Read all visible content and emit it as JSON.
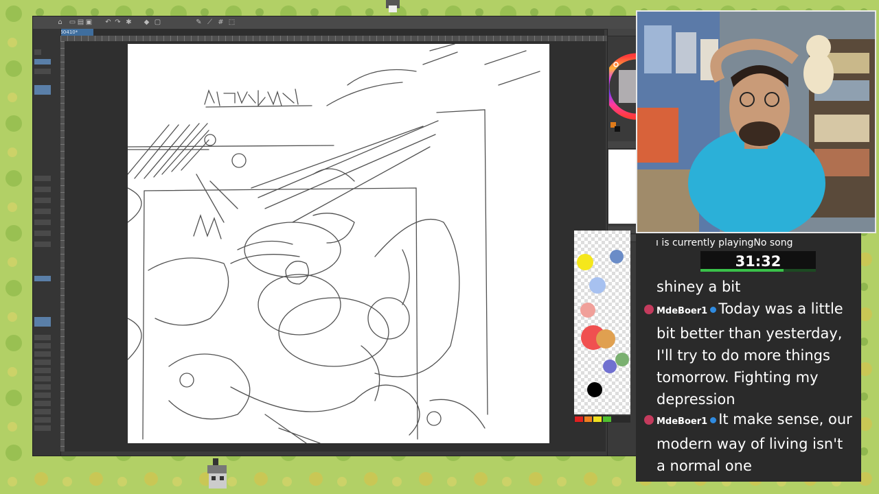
{
  "app": {
    "document_tab": "260410*"
  },
  "stream": {
    "now_playing": "ı is currently playingNo song",
    "timer": "31:32",
    "timer_progress": 0.72
  },
  "chat": {
    "messages": [
      {
        "user": "",
        "text": "shiney a bit"
      },
      {
        "user": "MdeBoer1",
        "text": "Today was a little bit better than yesterday, I'll try to do more things tomorrow. Fighting my depression"
      },
      {
        "user": "MdeBoer1",
        "text": "It make sense, our modern way of living isn't a normal one"
      }
    ]
  },
  "colors": {
    "background_green": "#a9c95a",
    "timer_green": "#3ac14a",
    "chat_badge": "#c43b5d",
    "verified_blue": "#2f8be0",
    "doc_tab_blue": "#3f6e9e"
  }
}
